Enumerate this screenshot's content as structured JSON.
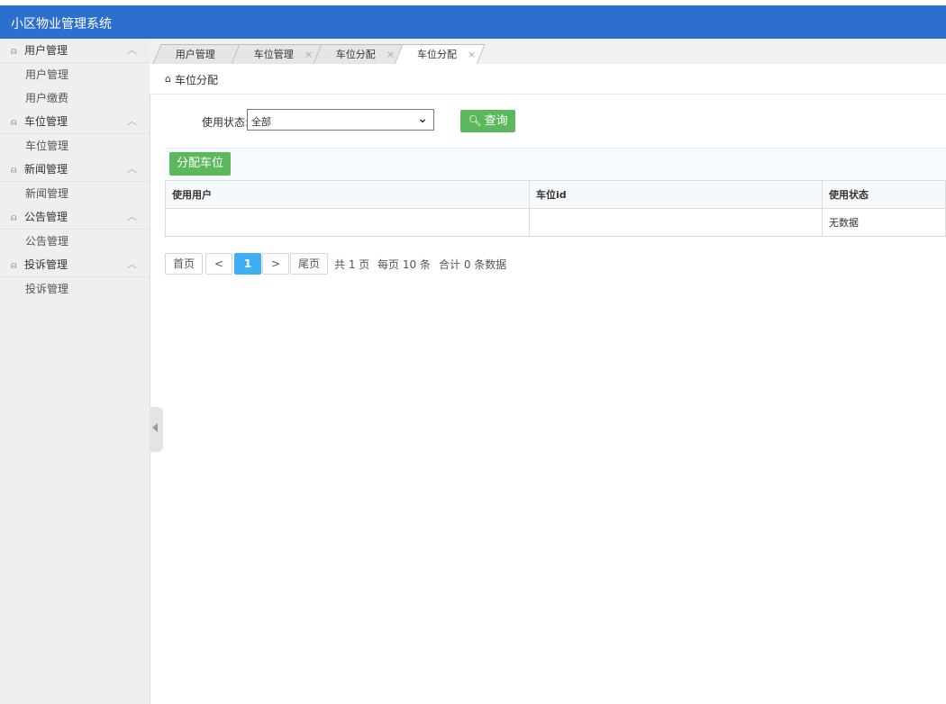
{
  "app": {
    "title": "小区物业管理系统"
  },
  "sidebar": {
    "groups": [
      {
        "label": "用户管理",
        "items": [
          "用户管理",
          "用户缴费"
        ]
      },
      {
        "label": "车位管理",
        "items": [
          "车位管理"
        ]
      },
      {
        "label": "新闻管理",
        "items": [
          "新闻管理"
        ]
      },
      {
        "label": "公告管理",
        "items": [
          "公告管理"
        ]
      },
      {
        "label": "投诉管理",
        "items": [
          "投诉管理"
        ]
      }
    ]
  },
  "tabs": [
    {
      "label": "用户管理",
      "close": ""
    },
    {
      "label": "车位管理",
      "close": "×"
    },
    {
      "label": "车位分配",
      "close": "×"
    },
    {
      "label": "车位分配",
      "close": "×",
      "active": true
    }
  ],
  "breadcrumb": {
    "text": "车位分配"
  },
  "filter": {
    "label": "使用状态:",
    "value": "全部",
    "search_button": "查询"
  },
  "toolbar": {
    "assign_button": "分配车位"
  },
  "table": {
    "headers": [
      "使用用户",
      "车位id",
      "使用状态"
    ],
    "empty_text": "无数据"
  },
  "pagination": {
    "first": "首页",
    "prev": "<",
    "page": "1",
    "next": ">",
    "last": "尾页",
    "total_pages_text": "共 1 页",
    "per_page_text": "每页 10 条",
    "total_records_text": "合计 0 条数据"
  },
  "colors": {
    "header_bg": "#2d6fcf",
    "button_green": "#5cb85c",
    "page_active": "#3eaff5"
  }
}
